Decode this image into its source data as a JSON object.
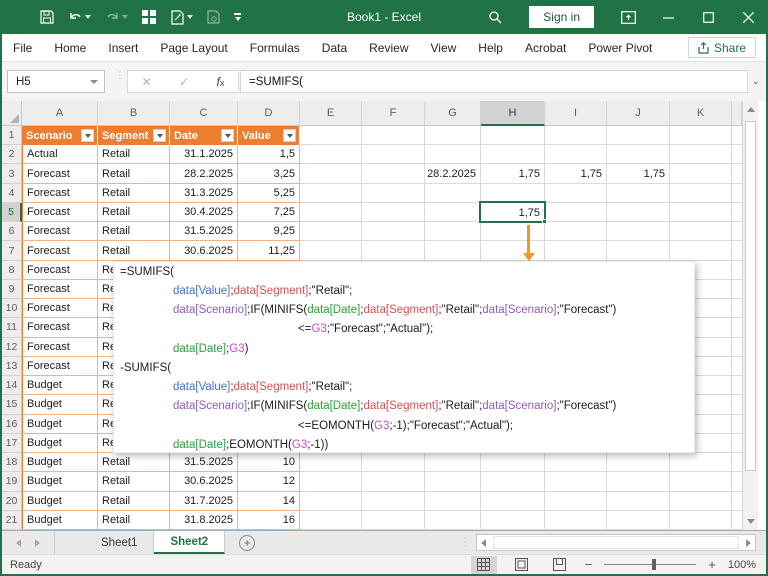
{
  "window": {
    "title": "Book1 - Excel",
    "sign_in_label": "Sign in"
  },
  "ribbon": {
    "tabs": [
      "File",
      "Home",
      "Insert",
      "Page Layout",
      "Formulas",
      "Data",
      "Review",
      "View",
      "Help",
      "Acrobat",
      "Power Pivot"
    ],
    "share_label": "Share"
  },
  "formula_bar": {
    "name_box": "H5",
    "formula": "=SUMIFS("
  },
  "sheet": {
    "columns": [
      "A",
      "B",
      "C",
      "D",
      "E",
      "F",
      "G",
      "H",
      "I",
      "J",
      "K"
    ],
    "selected_column": "H",
    "selected_row": 5,
    "row_count": 21,
    "table": {
      "headers": [
        "Scenario",
        "Segment",
        "Date",
        "Value"
      ],
      "rows": [
        {
          "r": 2,
          "scenario": "Actual",
          "segment": "Retail",
          "date": "31.1.2025",
          "value": "1,5"
        },
        {
          "r": 3,
          "scenario": "Forecast",
          "segment": "Retail",
          "date": "28.2.2025",
          "value": "3,25"
        },
        {
          "r": 4,
          "scenario": "Forecast",
          "segment": "Retail",
          "date": "31.3.2025",
          "value": "5,25"
        },
        {
          "r": 5,
          "scenario": "Forecast",
          "segment": "Retail",
          "date": "30.4.2025",
          "value": "7,25"
        },
        {
          "r": 6,
          "scenario": "Forecast",
          "segment": "Retail",
          "date": "31.5.2025",
          "value": "9,25"
        },
        {
          "r": 7,
          "scenario": "Forecast",
          "segment": "Retail",
          "date": "30.6.2025",
          "value": "11,25"
        },
        {
          "r": 8,
          "scenario": "Forecast",
          "segment": "Retail",
          "date": "",
          "value": ""
        },
        {
          "r": 9,
          "scenario": "Forecast",
          "segment": "Retail",
          "date": "",
          "value": ""
        },
        {
          "r": 10,
          "scenario": "Forecast",
          "segment": "Retail",
          "date": "",
          "value": ""
        },
        {
          "r": 11,
          "scenario": "Forecast",
          "segment": "Retail",
          "date": "",
          "value": ""
        },
        {
          "r": 12,
          "scenario": "Forecast",
          "segment": "Retail",
          "date": "",
          "value": ""
        },
        {
          "r": 13,
          "scenario": "Forecast",
          "segment": "Retail",
          "date": "",
          "value": ""
        },
        {
          "r": 14,
          "scenario": "Budget",
          "segment": "Retail",
          "date": "",
          "value": ""
        },
        {
          "r": 15,
          "scenario": "Budget",
          "segment": "Retail",
          "date": "",
          "value": ""
        },
        {
          "r": 16,
          "scenario": "Budget",
          "segment": "Retail",
          "date": "",
          "value": ""
        },
        {
          "r": 17,
          "scenario": "Budget",
          "segment": "Retail",
          "date": "",
          "value": ""
        },
        {
          "r": 18,
          "scenario": "Budget",
          "segment": "Retail",
          "date": "31.5.2025",
          "value": "10"
        },
        {
          "r": 19,
          "scenario": "Budget",
          "segment": "Retail",
          "date": "30.6.2025",
          "value": "12"
        },
        {
          "r": 20,
          "scenario": "Budget",
          "segment": "Retail",
          "date": "31.7.2025",
          "value": "14"
        },
        {
          "r": 21,
          "scenario": "Budget",
          "segment": "Retail",
          "date": "31.8.2025",
          "value": "16"
        }
      ]
    },
    "cells": [
      {
        "col": "G",
        "row": 3,
        "value": "28.2.2025"
      },
      {
        "col": "H",
        "row": 3,
        "value": "1,75"
      },
      {
        "col": "I",
        "row": 3,
        "value": "1,75"
      },
      {
        "col": "J",
        "row": 3,
        "value": "1,75"
      },
      {
        "col": "H",
        "row": 5,
        "value": "1,75"
      }
    ]
  },
  "formula_tooltip": {
    "colors": {
      "k": "#1c1c1c",
      "b": "#4472C4",
      "r": "#D0545B",
      "g": "#2CA03C",
      "p": "#8E5FBE",
      "m": "#C84FC8"
    },
    "lines": [
      {
        "indent": 0,
        "segments": [
          [
            "=SUMIFS(",
            "k"
          ]
        ]
      },
      {
        "indent": 1,
        "segments": [
          [
            "data[Value]",
            "b"
          ],
          [
            ";",
            "k"
          ],
          [
            "data[Segment]",
            "r"
          ],
          [
            ";\"Retail\";",
            "k"
          ]
        ]
      },
      {
        "indent": 1,
        "segments": [
          [
            "data[Scenario]",
            "p"
          ],
          [
            ";IF(MINIFS(",
            "k"
          ],
          [
            "data[Date]",
            "g"
          ],
          [
            ";",
            "k"
          ],
          [
            "data[Segment]",
            "r"
          ],
          [
            ";\"Retail\";",
            "k"
          ],
          [
            "data[Scenario]",
            "p"
          ],
          [
            ";\"Forecast\")",
            "k"
          ]
        ]
      },
      {
        "indent": 2,
        "segments": [
          [
            "<=",
            "k"
          ],
          [
            "G3",
            "m"
          ],
          [
            ";\"Forecast\";\"Actual\");",
            "k"
          ]
        ]
      },
      {
        "indent": 1,
        "segments": [
          [
            "data[Date]",
            "g"
          ],
          [
            ";",
            "k"
          ],
          [
            "G3",
            "m"
          ],
          [
            ")",
            "k"
          ]
        ]
      },
      {
        "indent": 0,
        "segments": [
          [
            "-SUMIFS(",
            "k"
          ]
        ]
      },
      {
        "indent": 1,
        "segments": [
          [
            "data[Value]",
            "b"
          ],
          [
            ";",
            "k"
          ],
          [
            "data[Segment]",
            "r"
          ],
          [
            ";\"Retail\";",
            "k"
          ]
        ]
      },
      {
        "indent": 1,
        "segments": [
          [
            "data[Scenario]",
            "p"
          ],
          [
            ";IF(MINIFS(",
            "k"
          ],
          [
            "data[Date]",
            "g"
          ],
          [
            ";",
            "k"
          ],
          [
            "data[Segment]",
            "r"
          ],
          [
            ";\"Retail\";",
            "k"
          ],
          [
            "data[Scenario]",
            "p"
          ],
          [
            ";\"Forecast\")",
            "k"
          ]
        ]
      },
      {
        "indent": 2,
        "segments": [
          [
            "<=EOMONTH(",
            "k"
          ],
          [
            "G3",
            "m"
          ],
          [
            ";-1);\"Forecast\";\"Actual\");",
            "k"
          ]
        ]
      },
      {
        "indent": 1,
        "segments": [
          [
            "data[Date]",
            "g"
          ],
          [
            ";EOMONTH(",
            "k"
          ],
          [
            "G3",
            "m"
          ],
          [
            ";-1))",
            "k"
          ]
        ]
      }
    ]
  },
  "sheet_tabs": {
    "items": [
      {
        "label": "Sheet1",
        "active": false
      },
      {
        "label": "Sheet2",
        "active": true
      }
    ]
  },
  "status_bar": {
    "status": "Ready",
    "zoom_level": "100%"
  },
  "theme": {
    "title_green": "#217346",
    "table_orange": "#ED7D31",
    "table_border_orange": "#F4B183",
    "arrow_orange": "#F09820",
    "selection_green": "#217346"
  }
}
